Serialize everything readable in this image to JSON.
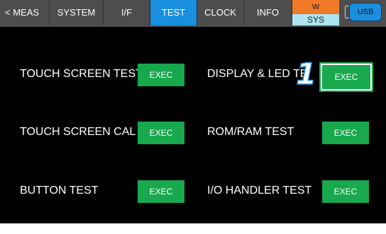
{
  "tabs": {
    "back_label": "< MEAS",
    "system_label": "SYSTEM",
    "if_label": "I/F",
    "test_label": "TEST",
    "clock_label": "CLOCK",
    "info_label": "INFO",
    "active": "TEST"
  },
  "status": {
    "w_label": "W",
    "sys_label": "SYS",
    "usb_label": "USB"
  },
  "tests": {
    "touch_screen_test": {
      "label": "TOUCH SCREEN TEST",
      "button": "EXEC"
    },
    "display_led_test": {
      "label": "DISPLAY & LED TE",
      "button": "EXEC"
    },
    "touch_screen_cal": {
      "label": "TOUCH SCREEN CAL",
      "button": "EXEC"
    },
    "rom_ram_test": {
      "label": "ROM/RAM TEST",
      "button": "EXEC"
    },
    "button_test": {
      "label": "BUTTON TEST",
      "button": "EXEC"
    },
    "io_handler_test": {
      "label": "I/O HANDLER TEST",
      "button": "EXEC"
    }
  },
  "callout": {
    "number": "1"
  },
  "colors": {
    "tab_bar": "#4d4d4d",
    "active_tab": "#1a8fe0",
    "exec_button": "#18a84e",
    "w_indicator": "#f07a28",
    "sys_indicator": "#aee4f0",
    "screen": "#000000"
  }
}
